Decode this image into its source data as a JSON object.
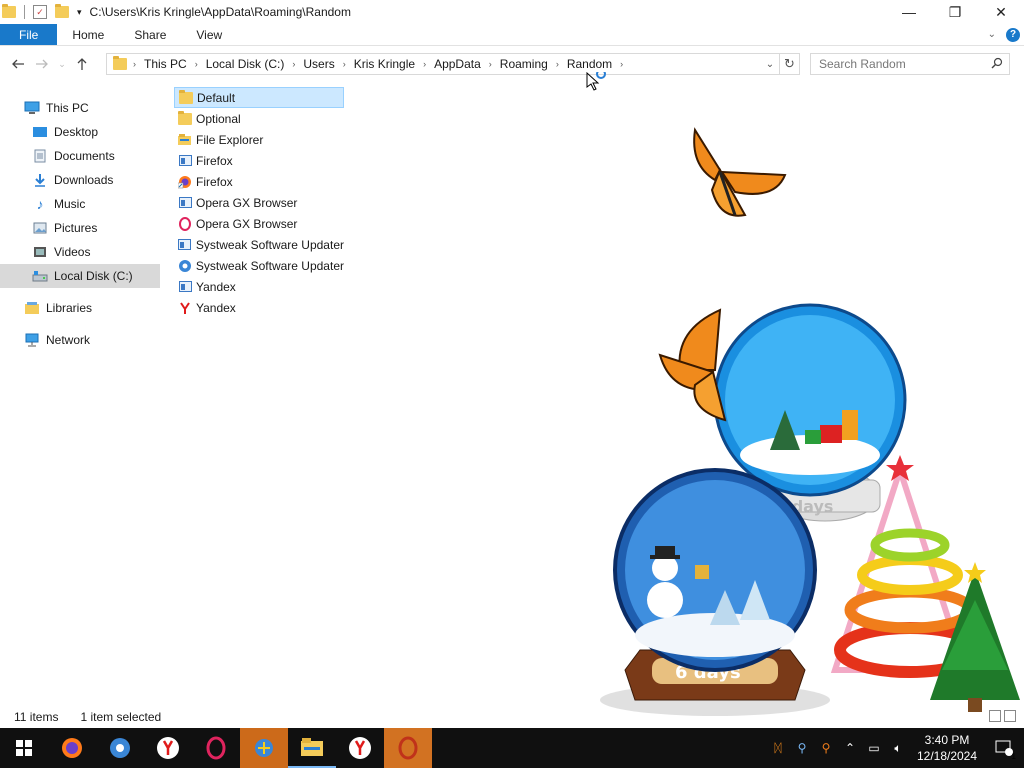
{
  "window": {
    "title_path": "C:\\Users\\Kris Kringle\\AppData\\Roaming\\Random",
    "controls": {
      "minimize": "—",
      "maximize": "❐",
      "close": "✕"
    }
  },
  "ribbon": {
    "tabs": [
      "File",
      "Home",
      "Share",
      "View"
    ]
  },
  "address": {
    "crumbs": [
      "This PC",
      "Local Disk (C:)",
      "Users",
      "Kris Kringle",
      "AppData",
      "Roaming",
      "Random"
    ]
  },
  "search": {
    "placeholder": "Search Random"
  },
  "nav_pane": {
    "items": [
      {
        "label": "This PC",
        "icon": "this-pc-icon"
      },
      {
        "label": "Desktop",
        "icon": "desktop-icon"
      },
      {
        "label": "Documents",
        "icon": "documents-icon"
      },
      {
        "label": "Downloads",
        "icon": "downloads-icon"
      },
      {
        "label": "Music",
        "icon": "music-icon"
      },
      {
        "label": "Pictures",
        "icon": "pictures-icon"
      },
      {
        "label": "Videos",
        "icon": "videos-icon"
      },
      {
        "label": "Local Disk (C:)",
        "icon": "local-disk-icon"
      },
      {
        "label": "Libraries",
        "icon": "libraries-icon"
      },
      {
        "label": "Network",
        "icon": "network-icon"
      }
    ]
  },
  "files": [
    {
      "name": "Default",
      "icon": "folder-icon"
    },
    {
      "name": "Optional",
      "icon": "folder-icon"
    },
    {
      "name": "File Explorer",
      "icon": "file-explorer-icon"
    },
    {
      "name": "Firefox",
      "icon": "shortcut-icon"
    },
    {
      "name": "Firefox",
      "icon": "firefox-icon"
    },
    {
      "name": "Opera GX Browser",
      "icon": "shortcut-icon"
    },
    {
      "name": "Opera GX Browser",
      "icon": "opera-gx-icon"
    },
    {
      "name": "Systweak Software Updater",
      "icon": "shortcut-icon"
    },
    {
      "name": "Systweak Software Updater",
      "icon": "systweak-icon"
    },
    {
      "name": "Yandex",
      "icon": "shortcut-icon"
    },
    {
      "name": "Yandex",
      "icon": "yandex-icon"
    }
  ],
  "status": {
    "items_count": "11 items",
    "selection": "1 item selected"
  },
  "desktop_art": {
    "globe_label_1": "6 days",
    "globe_label_2": "6 days"
  },
  "taskbar": {
    "time": "3:40 PM",
    "date": "12/18/2024",
    "notification_count": "1"
  },
  "colors": {
    "accent": "#1979ca",
    "taskbar": "#101010",
    "selected_row": "#cce8ff",
    "active_taskbar": "#cc6a1a"
  }
}
